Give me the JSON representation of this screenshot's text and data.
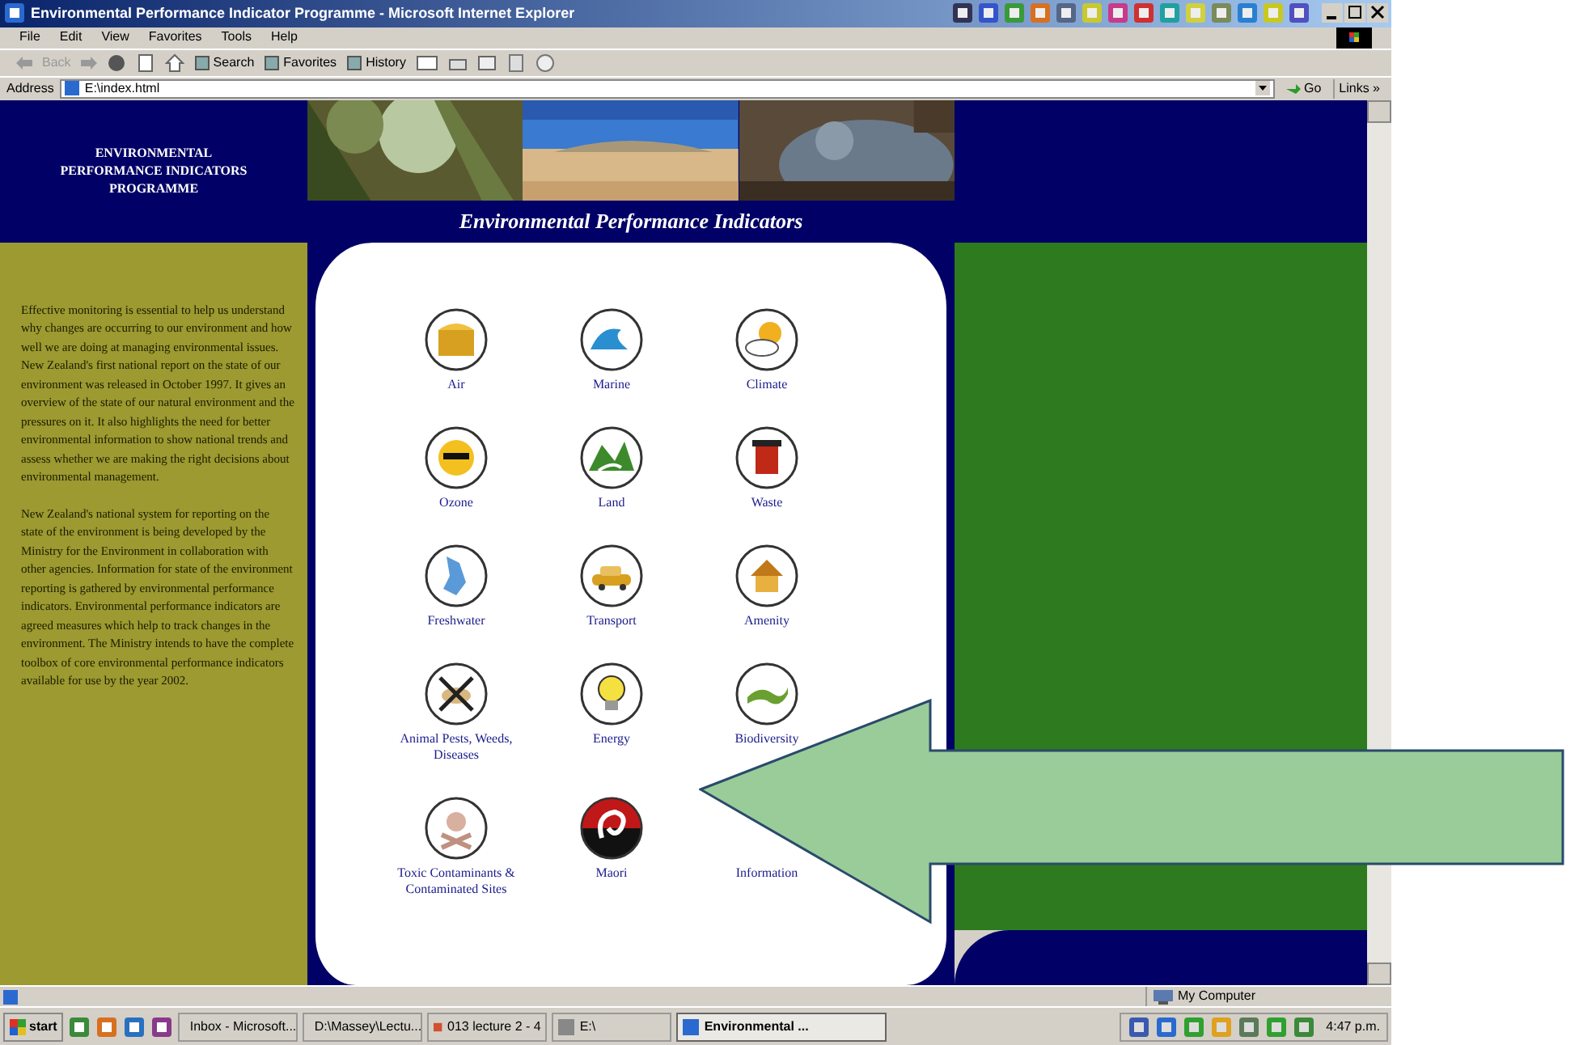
{
  "window": {
    "title": "Environmental Performance Indicator Programme - Microsoft Internet Explorer",
    "menu": [
      "File",
      "Edit",
      "View",
      "Favorites",
      "Tools",
      "Help"
    ],
    "toolbar": [
      {
        "label": "Back",
        "disabled": true
      },
      {
        "label": "Search",
        "disabled": false
      },
      {
        "label": "Favorites",
        "disabled": false
      },
      {
        "label": "History",
        "disabled": false
      }
    ],
    "address_label": "Address",
    "address": "E:\\index.html",
    "go": "Go",
    "links": "Links »"
  },
  "page": {
    "logo_lines": [
      "ENVIRONMENTAL",
      "PERFORMANCE INDICATORS",
      "PROGRAMME"
    ],
    "banner_title": "Environmental Performance Indicators",
    "intro": [
      "Effective monitoring is essential to help us understand why changes are occurring to our environment and how well we are doing at managing environmental issues. New Zealand's first national report on the state of our environment was released in October 1997. It gives an overview of the state of our natural environment and the pressures on it. It also highlights the need for better environmental information to show national trends and assess whether we are making the right decisions about environmental management.",
      "New Zealand's national system for reporting on the state of the environment is being developed by the Ministry for the Environment in collaboration with other agencies. Information for state of the environment reporting is gathered by environmental performance indicators. Environmental performance indicators are agreed measures which help to track changes in the environment. The Ministry intends to have the complete toolbox of core environmental performance indicators available for use by the year 2002."
    ],
    "indicators": [
      {
        "label": "Air"
      },
      {
        "label": "Marine"
      },
      {
        "label": "Climate"
      },
      {
        "label": "Ozone"
      },
      {
        "label": "Land"
      },
      {
        "label": "Waste"
      },
      {
        "label": "Freshwater"
      },
      {
        "label": "Transport"
      },
      {
        "label": "Amenity"
      },
      {
        "label": "Animal Pests, Weeds, Diseases"
      },
      {
        "label": "Energy"
      },
      {
        "label": "Biodiversity"
      },
      {
        "label": "Toxic Contaminants & Contaminated Sites"
      },
      {
        "label": "Maori"
      },
      {
        "label": "Information"
      }
    ]
  },
  "status_bar": {
    "zone": "My Computer"
  },
  "taskbar": {
    "start": "start",
    "items": [
      {
        "label": "Inbox - Microsoft...",
        "selected": false
      },
      {
        "label": "D:\\Massey\\Lectu...",
        "selected": false
      },
      {
        "label": "013 lecture 2 - 4",
        "selected": false
      },
      {
        "label": "E:\\",
        "selected": false
      },
      {
        "label": "Environmental ...",
        "selected": true
      }
    ],
    "clock": "4:47 p.m."
  }
}
